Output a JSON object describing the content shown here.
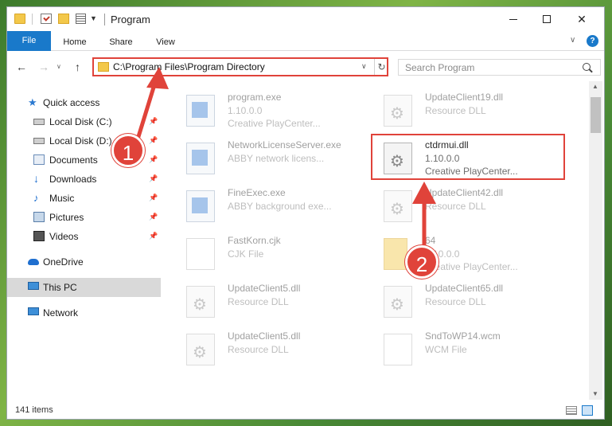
{
  "window": {
    "title": "Program",
    "controls": {
      "minimize": "",
      "maximize": "",
      "close": "✕"
    }
  },
  "ribbon": {
    "tabs": [
      "File",
      "Home",
      "Share",
      "View"
    ],
    "collapse_glyph": "∨",
    "help": "?"
  },
  "address_bar": {
    "path": "C:\\Program Files\\Program Directory",
    "refresh_glyph": "↻",
    "dropdown_glyph": "∨"
  },
  "search": {
    "placeholder": "Search Program"
  },
  "nav_glyphs": {
    "back": "←",
    "forward": "→",
    "recent": "∨",
    "up": "↑"
  },
  "sidebar": {
    "items": [
      {
        "label": "Quick access",
        "icon": "star-icon"
      },
      {
        "label": "Local Disk (C:)",
        "icon": "disk-icon",
        "pinned": true
      },
      {
        "label": "Local Disk (D:)",
        "icon": "disk-icon",
        "pinned": true
      },
      {
        "label": "Documents",
        "icon": "documents-icon",
        "pinned": true
      },
      {
        "label": "Downloads",
        "icon": "download-icon",
        "pinned": true
      },
      {
        "label": "Music",
        "icon": "music-icon",
        "pinned": true
      },
      {
        "label": "Pictures",
        "icon": "pictures-icon",
        "pinned": true
      },
      {
        "label": "Videos",
        "icon": "videos-icon",
        "pinned": true
      },
      {
        "label": "OneDrive",
        "icon": "cloud-icon"
      },
      {
        "label": "This PC",
        "icon": "computer-icon",
        "selected": true
      },
      {
        "label": "Network",
        "icon": "network-icon"
      }
    ]
  },
  "files": [
    {
      "name": "program.exe",
      "line2": "1.10.0.0",
      "line3": "Creative PlayCenter...",
      "icon": "exe-icon"
    },
    {
      "name": "UpdateClient19.dll",
      "line2": "Resource DLL",
      "line3": "",
      "icon": "dll-icon"
    },
    {
      "name": "NetworkLicenseServer.exe",
      "line2": "ABBY network licens...",
      "line3": "",
      "icon": "exe-icon"
    },
    {
      "name": "ctdrmui.dll",
      "line2": "1.10.0.0",
      "line3": "Creative PlayCenter...",
      "icon": "dll-icon",
      "highlighted": true
    },
    {
      "name": "FineExec.exe",
      "line2": "ABBY background exe...",
      "line3": "",
      "icon": "exe-icon"
    },
    {
      "name": "UpdateClient42.dll",
      "line2": "Resource DLL",
      "line3": "",
      "icon": "dll-icon"
    },
    {
      "name": "FastKorn.cjk",
      "line2": "CJK File",
      "line3": "",
      "icon": "document-icon"
    },
    {
      "name": "64",
      "line2": "1.10.0.0",
      "line3": "Creative PlayCenter...",
      "icon": "folder-icon"
    },
    {
      "name": "UpdateClient5.dll",
      "line2": "Resource DLL",
      "line3": "",
      "icon": "dll-icon"
    },
    {
      "name": "UpdateClient65.dll",
      "line2": "Resource DLL",
      "line3": "",
      "icon": "dll-icon"
    },
    {
      "name": "UpdateClient5.dll",
      "line2": "Resource DLL",
      "line3": "",
      "icon": "dll-icon"
    },
    {
      "name": "SndToWP14.wcm",
      "line2": "WCM File",
      "line3": "",
      "icon": "document-icon"
    }
  ],
  "status_bar": {
    "item_count": "141 items"
  },
  "annotations": {
    "badge_1": "1",
    "badge_2": "2"
  },
  "colors": {
    "accent": "#1979ca",
    "annotation": "#e0433a",
    "selection": "#d9d9d9"
  }
}
